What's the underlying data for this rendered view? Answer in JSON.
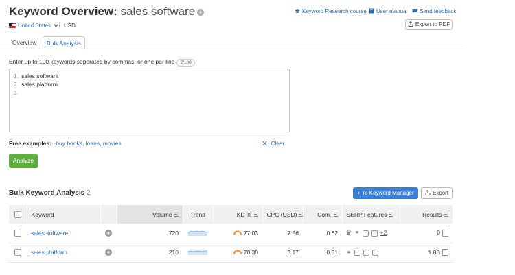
{
  "header": {
    "title": "Keyword Overview:",
    "keyword": "sales software",
    "links": {
      "course": "Keyword Research course",
      "manual": "User manual",
      "feedback": "Send feedback"
    },
    "export_pdf": "Export to PDF",
    "database": "United States",
    "currency": "USD"
  },
  "tabs": [
    {
      "label": "Overview",
      "active": false
    },
    {
      "label": "Bulk Analysis",
      "active": true
    }
  ],
  "bulk": {
    "instruction": "Enter up to 100 keywords separated by commas, or one per line",
    "count_badge": "2/100",
    "lines": [
      {
        "num": "1.",
        "text": "sales software"
      },
      {
        "num": "2.",
        "text": "sales platform"
      },
      {
        "num": "3.",
        "text": ""
      }
    ],
    "free_label": "Free examples:",
    "free_examples": "buy books, loans, movies",
    "clear": "Clear",
    "analyze": "Analyze"
  },
  "results": {
    "title": "Bulk Keyword Analysis",
    "count": "2",
    "to_manager": "+ To Keyword Manager",
    "export": "Export",
    "columns": {
      "keyword": "Keyword",
      "volume": "Volume",
      "trend": "Trend",
      "kd": "KD %",
      "cpc": "CPC (USD)",
      "com": "Com.",
      "serp": "SERP Features",
      "results": "Results"
    },
    "rows": [
      {
        "keyword": "sales software",
        "volume": "720",
        "kd": "77.03",
        "cpc": "7.56",
        "com": "0.62",
        "serp_more": "+2",
        "results": "0"
      },
      {
        "keyword": "sales platform",
        "volume": "210",
        "kd": "70.30",
        "cpc": "3.17",
        "com": "0.51",
        "serp_more": "",
        "results": "1.8B"
      }
    ]
  },
  "colors": {
    "link": "#2b6cb0",
    "analyze": "#5fae3f",
    "primary_button": "#3d7fd6",
    "kd_gauge": "#f08a24"
  }
}
